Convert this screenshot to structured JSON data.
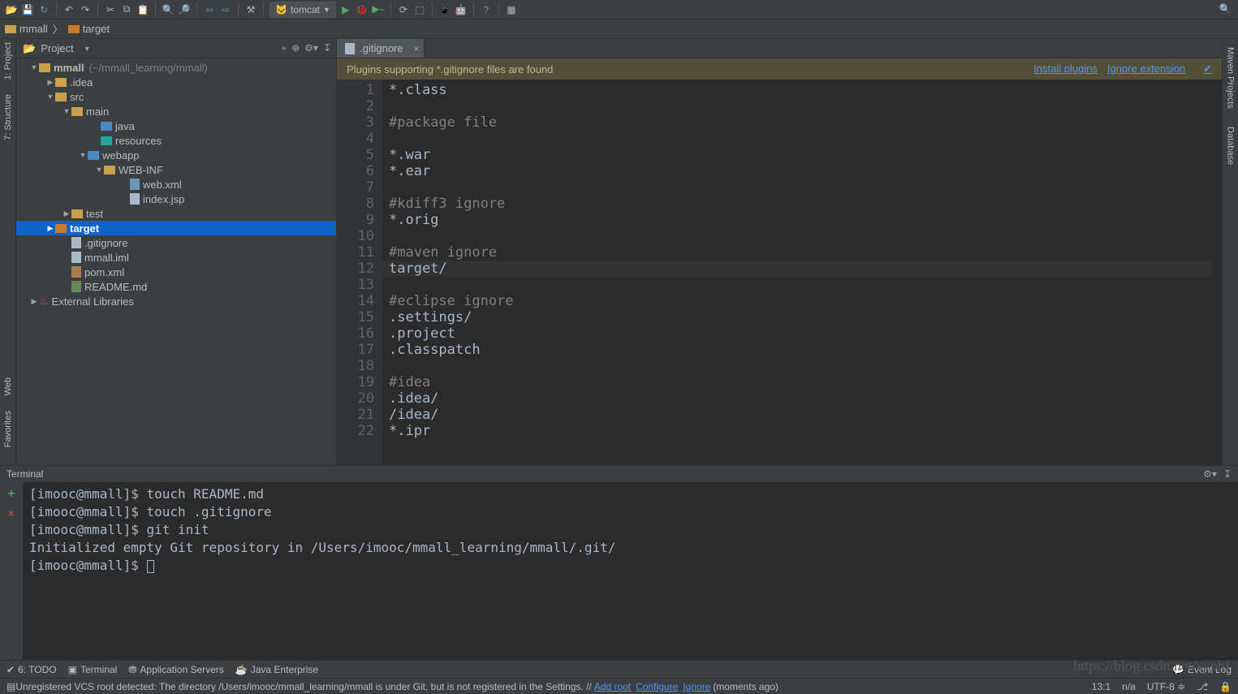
{
  "toolbar": {
    "run_config_label": "tomcat"
  },
  "breadcrumb": {
    "items": [
      "mmall",
      "target"
    ]
  },
  "left_gutter": {
    "labels": [
      "1: Project",
      "7: Structure"
    ]
  },
  "right_gutter": {
    "labels": [
      "Maven Projects",
      "Database"
    ]
  },
  "project_header": {
    "title": "Project"
  },
  "tree": {
    "root_name": "mmall",
    "root_path": "(~/mmall_learning/mmall)",
    "ext_libs": "External Libraries",
    "items": [
      ".idea",
      "src",
      "main",
      "java",
      "resources",
      "webapp",
      "WEB-INF",
      "web.xml",
      "index.jsp",
      "test",
      "target",
      ".gitignore",
      "mmall.iml",
      "pom.xml",
      "README.md"
    ]
  },
  "editor": {
    "tab_name": ".gitignore",
    "notice_text": "Plugins supporting *.gitignore files are found",
    "notice_link1": "Install plugins",
    "notice_link2": "Ignore extension",
    "lines": [
      "*.class",
      "",
      "#package file",
      "",
      "*.war",
      "*.ear",
      "",
      "#kdiff3 ignore",
      "*.orig",
      "",
      "#maven ignore",
      "target/",
      "",
      "#eclipse ignore",
      ".settings/",
      ".project",
      ".classpatch",
      "",
      "#idea",
      ".idea/",
      "/idea/",
      "*.ipr"
    ],
    "highlight_line": 12
  },
  "terminal": {
    "title": "Terminal",
    "lines": [
      "[imooc@mmall]$ touch README.md",
      "[imooc@mmall]$ touch .gitignore",
      "[imooc@mmall]$ git init",
      "Initialized empty Git repository in /Users/imooc/mmall_learning/mmall/.git/",
      "[imooc@mmall]$ "
    ]
  },
  "bottom_tabs": {
    "todo": "6: TODO",
    "terminal": "Terminal",
    "appservers": "Application Servers",
    "javaee": "Java Enterprise",
    "eventlog": "Event Log"
  },
  "status": {
    "message_prefix": "Unregistered VCS root detected: The directory /Users/imooc/mmall_learning/mmall is under Git, but is not registered in the Settings. // ",
    "link_add": "Add root",
    "link_conf": "Configure",
    "link_ign": "Ignore",
    "suffix": " (moments ago)",
    "pos": "13:1",
    "insert": "n/a",
    "encoding": "UTF-8",
    "branch": "⎇"
  },
  "left_side": {
    "favorites": "Favorites",
    "web": "Web"
  },
  "watermark": "https://blog.csdn.net/xyphf"
}
